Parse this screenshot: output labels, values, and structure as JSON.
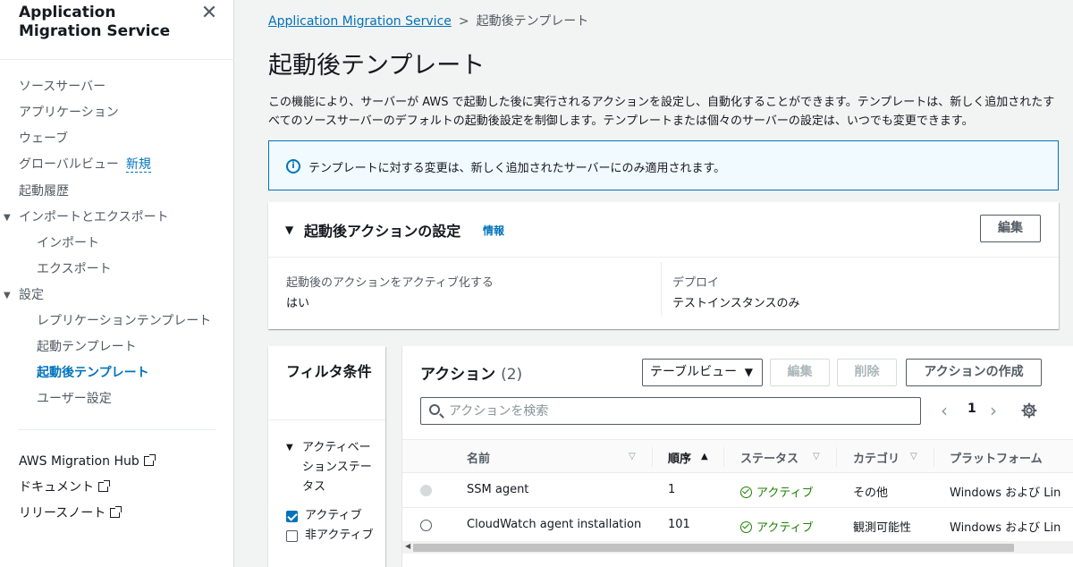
{
  "sidebar": {
    "title": "Application Migration Service",
    "items": [
      {
        "label": "ソースサーバー"
      },
      {
        "label": "アプリケーション"
      },
      {
        "label": "ウェーブ"
      },
      {
        "label": "グローバルビュー",
        "badge": "新規"
      },
      {
        "label": "起動履歴"
      },
      {
        "label": "インポートとエクスポート"
      },
      {
        "label": "インポート"
      },
      {
        "label": "エクスポート"
      },
      {
        "label": "設定"
      },
      {
        "label": "レプリケーションテンプレート"
      },
      {
        "label": "起動テンプレート"
      },
      {
        "label": "起動後テンプレート"
      },
      {
        "label": "ユーザー設定"
      }
    ],
    "links": [
      {
        "label": "AWS Migration Hub"
      },
      {
        "label": "ドキュメント"
      },
      {
        "label": "リリースノート"
      }
    ]
  },
  "breadcrumb": {
    "root": "Application Migration Service",
    "separator": ">",
    "current": "起動後テンプレート"
  },
  "page": {
    "title": "起動後テンプレート",
    "description": "この機能により、サーバーが AWS で起動した後に実行されるアクションを設定し、自動化することができます。テンプレートは、新しく追加されたすべてのソースサーバーのデフォルトの起動後設定を制御します。テンプレートまたは個々のサーバーの設定は、いつでも変更できます。"
  },
  "info_alert": {
    "text": "テンプレートに対する変更は、新しく追加されたサーバーにのみ適用されます。"
  },
  "post_launch_settings": {
    "title": "起動後アクションの設定",
    "info_link": "情報",
    "edit_button": "編集",
    "fields": [
      {
        "label": "起動後のアクションをアクティブ化する",
        "value": "はい"
      },
      {
        "label": "デプロイ",
        "value": "テストインスタンスのみ"
      }
    ]
  },
  "filter": {
    "title": "フィルタ条件",
    "group_label": "アクティベーションステータス",
    "options": [
      {
        "label": "アクティブ",
        "checked": true
      },
      {
        "label": "非アクティブ",
        "checked": false
      }
    ]
  },
  "actions": {
    "title": "アクション",
    "count": "(2)",
    "view_select": "テーブルビュー",
    "edit_button": "編集",
    "delete_button": "削除",
    "create_button": "アクションの作成",
    "search_placeholder": "アクションを検索",
    "page": "1",
    "columns": [
      "名前",
      "順序",
      "ステータス",
      "カテゴリ",
      "プラットフォーム"
    ],
    "rows": [
      {
        "name": "SSM agent",
        "order": "1",
        "status": "アクティブ",
        "category": "その他",
        "platform": "Windows および Lin"
      },
      {
        "name": "CloudWatch agent installation",
        "order": "101",
        "status": "アクティブ",
        "category": "観測可能性",
        "platform": "Windows および Lin"
      }
    ]
  },
  "colors": {
    "link": "#0073bb",
    "success": "#1d8102",
    "info_bg": "#f1faff"
  }
}
